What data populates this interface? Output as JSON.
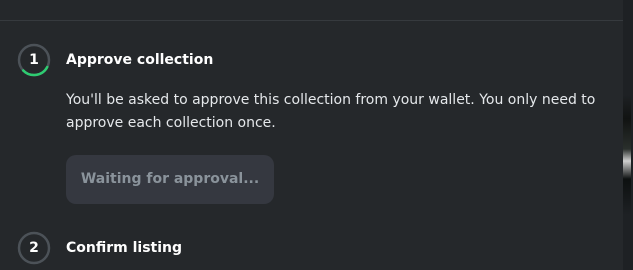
{
  "colors": {
    "modal_bg": "#25282b",
    "progress_green": "#2ecc71",
    "ring_grey": "#4c5258",
    "button_bg": "#353840",
    "button_text": "#8a939b"
  },
  "steps": [
    {
      "number": "1",
      "title": "Approve collection",
      "description": "You'll be asked to approve this collection from your wallet. You only need to approve each collection once.",
      "status": "in-progress",
      "button_label": "Waiting for approval..."
    },
    {
      "number": "2",
      "title": "Confirm listing",
      "status": "pending"
    }
  ]
}
